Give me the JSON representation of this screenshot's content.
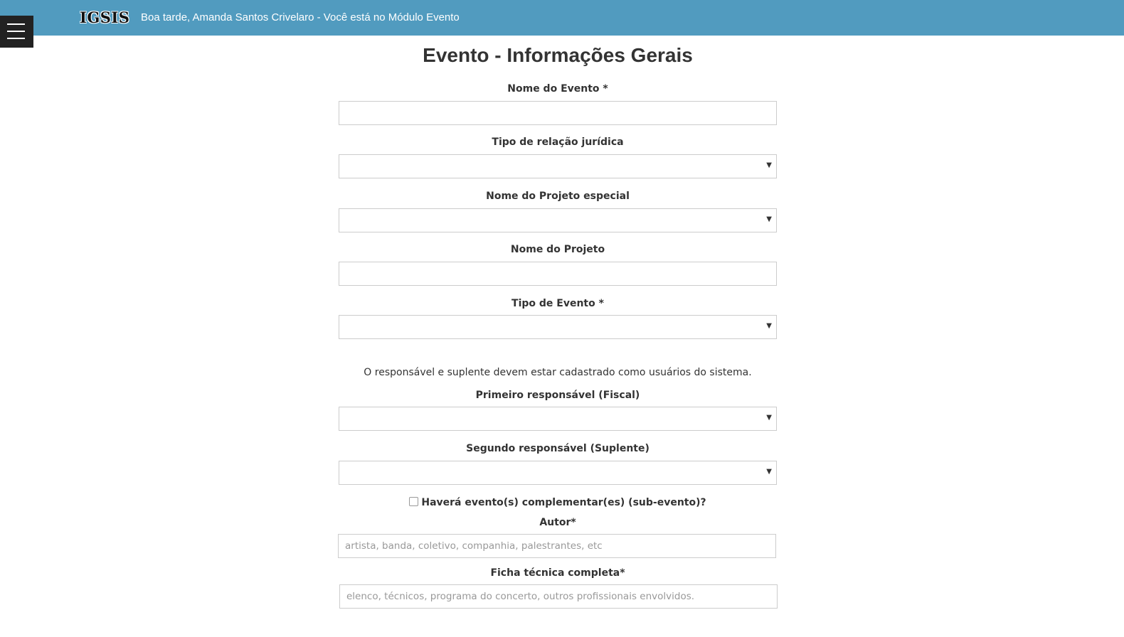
{
  "header": {
    "logo_text": "IGSIS",
    "greeting": "Boa tarde, Amanda Santos Crivelaro - Você está no Módulo Evento",
    "background_color": "#519bbf",
    "menu_icon": "hamburger-menu-icon"
  },
  "page": {
    "title": "Evento - Informações Gerais"
  },
  "form": {
    "nome_evento": {
      "label": "Nome do Evento *",
      "value": ""
    },
    "tipo_relacao": {
      "label": "Tipo de relação jurídica",
      "selected": ""
    },
    "projeto_especial": {
      "label": "Nome do Projeto especial",
      "selected": ""
    },
    "nome_projeto": {
      "label": "Nome do Projeto",
      "value": ""
    },
    "tipo_evento": {
      "label": "Tipo de Evento *",
      "selected": ""
    },
    "info_responsaveis": "O responsável e suplente devem estar cadastrado como usuários do sistema.",
    "primeiro_responsavel": {
      "label": "Primeiro responsável (Fiscal)",
      "selected": ""
    },
    "segundo_responsavel": {
      "label": "Segundo responsável (Suplente)",
      "selected": ""
    },
    "subevento": {
      "label": "Haverá evento(s) complementar(es) (sub-evento)?",
      "checked": false
    },
    "autor": {
      "label": "Autor*",
      "value": "",
      "placeholder": "artista, banda, coletivo, companhia, palestrantes, etc"
    },
    "ficha_tecnica": {
      "label": "Ficha técnica completa*",
      "value": "",
      "placeholder": "elenco, técnicos, programa do concerto, outros profissionais envolvidos."
    }
  }
}
